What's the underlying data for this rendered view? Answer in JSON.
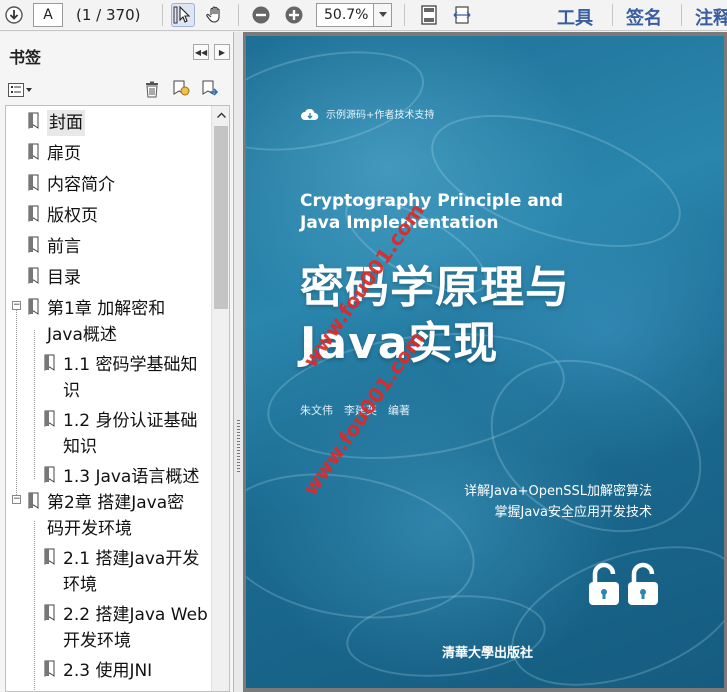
{
  "toolbar": {
    "page_input": "A",
    "page_count": "(1 / 370)",
    "zoom": "50.7%",
    "menu": {
      "tools": "工具",
      "sign": "签名",
      "comment": "注释"
    }
  },
  "bookmarks": {
    "title": "书签",
    "items": [
      {
        "label": "封面"
      },
      {
        "label": "扉页"
      },
      {
        "label": "内容简介"
      },
      {
        "label": "版权页"
      },
      {
        "label": "前言"
      },
      {
        "label": "目录"
      },
      {
        "line1": "第1章 加解密和",
        "line2": "Java概述"
      },
      {
        "line1": "1.1 密码学基础知",
        "line2": "识"
      },
      {
        "line1": "1.2 身份认证基础",
        "line2": "知识"
      },
      {
        "label": "1.3 Java语言概述"
      },
      {
        "line1": "第2章 搭建Java密",
        "line2": "码开发环境"
      },
      {
        "line1": "2.1 搭建Java开发",
        "line2": "环境"
      },
      {
        "line1": "2.2 搭建Java Web",
        "line2": "开发环境"
      },
      {
        "label": "2.3 使用JNI"
      }
    ]
  },
  "cover": {
    "badge": "示例源码+作者技术支持",
    "title_en_1": "Cryptography Principle and",
    "title_en_2": "Java Implementation",
    "title_cn_1": "密码学原理与",
    "title_cn_2": "Java实现",
    "authors": "朱文伟　李建英　编著",
    "tagline_1": "详解Java+OpenSSL加解密算法",
    "tagline_2": "掌握Java安全应用开发技术",
    "publisher": "清華大學出版社",
    "watermark_1": "www.fou001.com",
    "watermark_2": "www.fou001.com"
  },
  "colors": {
    "menu_text": "#3a5da0",
    "cover_blue": "#2a86ad",
    "watermark": "#e12828"
  }
}
